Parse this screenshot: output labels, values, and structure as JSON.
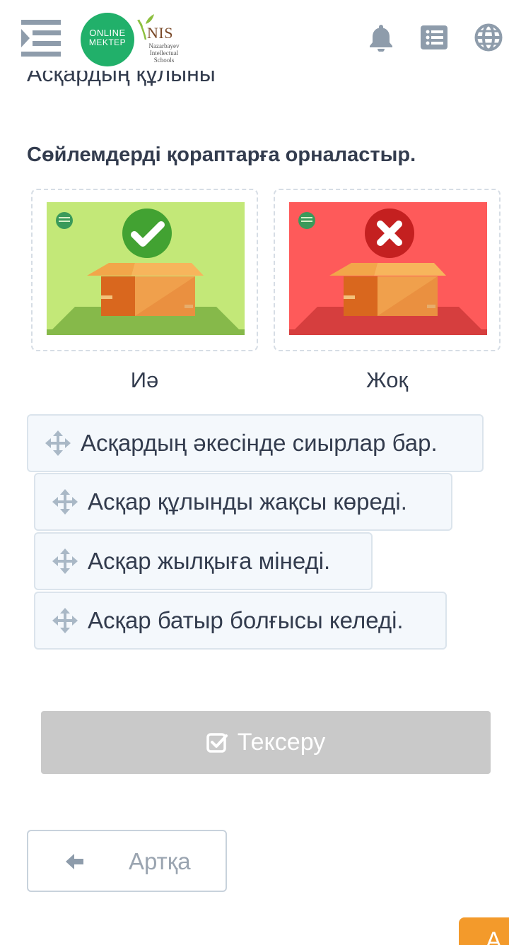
{
  "header": {
    "logo_online_line1": "ONLINE",
    "logo_online_line2": "MEKTEP",
    "logo_nis_title": "NIS",
    "logo_nis_sub1": "Nazarbayev",
    "logo_nis_sub2": "Intellectual",
    "logo_nis_sub3": "Schools",
    "icons": [
      "menu-icon",
      "bell-icon",
      "list-icon",
      "globe-icon"
    ]
  },
  "page_title": "Асқардың құлыны",
  "instruction": "Сөйлемдерді қораптарға орналастыр.",
  "zones": [
    {
      "label": "Иә",
      "color": "#c3e878",
      "icon": "check-icon"
    },
    {
      "label": "Жоқ",
      "color": "#fe5a5a",
      "icon": "cross-icon"
    }
  ],
  "items": [
    {
      "text": "Асқардың әкесінде сиырлар бар."
    },
    {
      "text": "Асқар құлынды жақсы көреді."
    },
    {
      "text": "Асқар жылқыға мінеді."
    },
    {
      "text": "Асқар батыр болғысы келеді."
    }
  ],
  "check_button": {
    "label": "Тексеру"
  },
  "back_button": {
    "label": "Артқа"
  },
  "next_tab": {
    "label": "А"
  },
  "colors": {
    "text": "#333c4e",
    "icon_gray": "#8e9cab",
    "brand_green": "#21b06a",
    "disabled_button": "#c9c9c9",
    "accent_orange": "#f39a2b"
  }
}
